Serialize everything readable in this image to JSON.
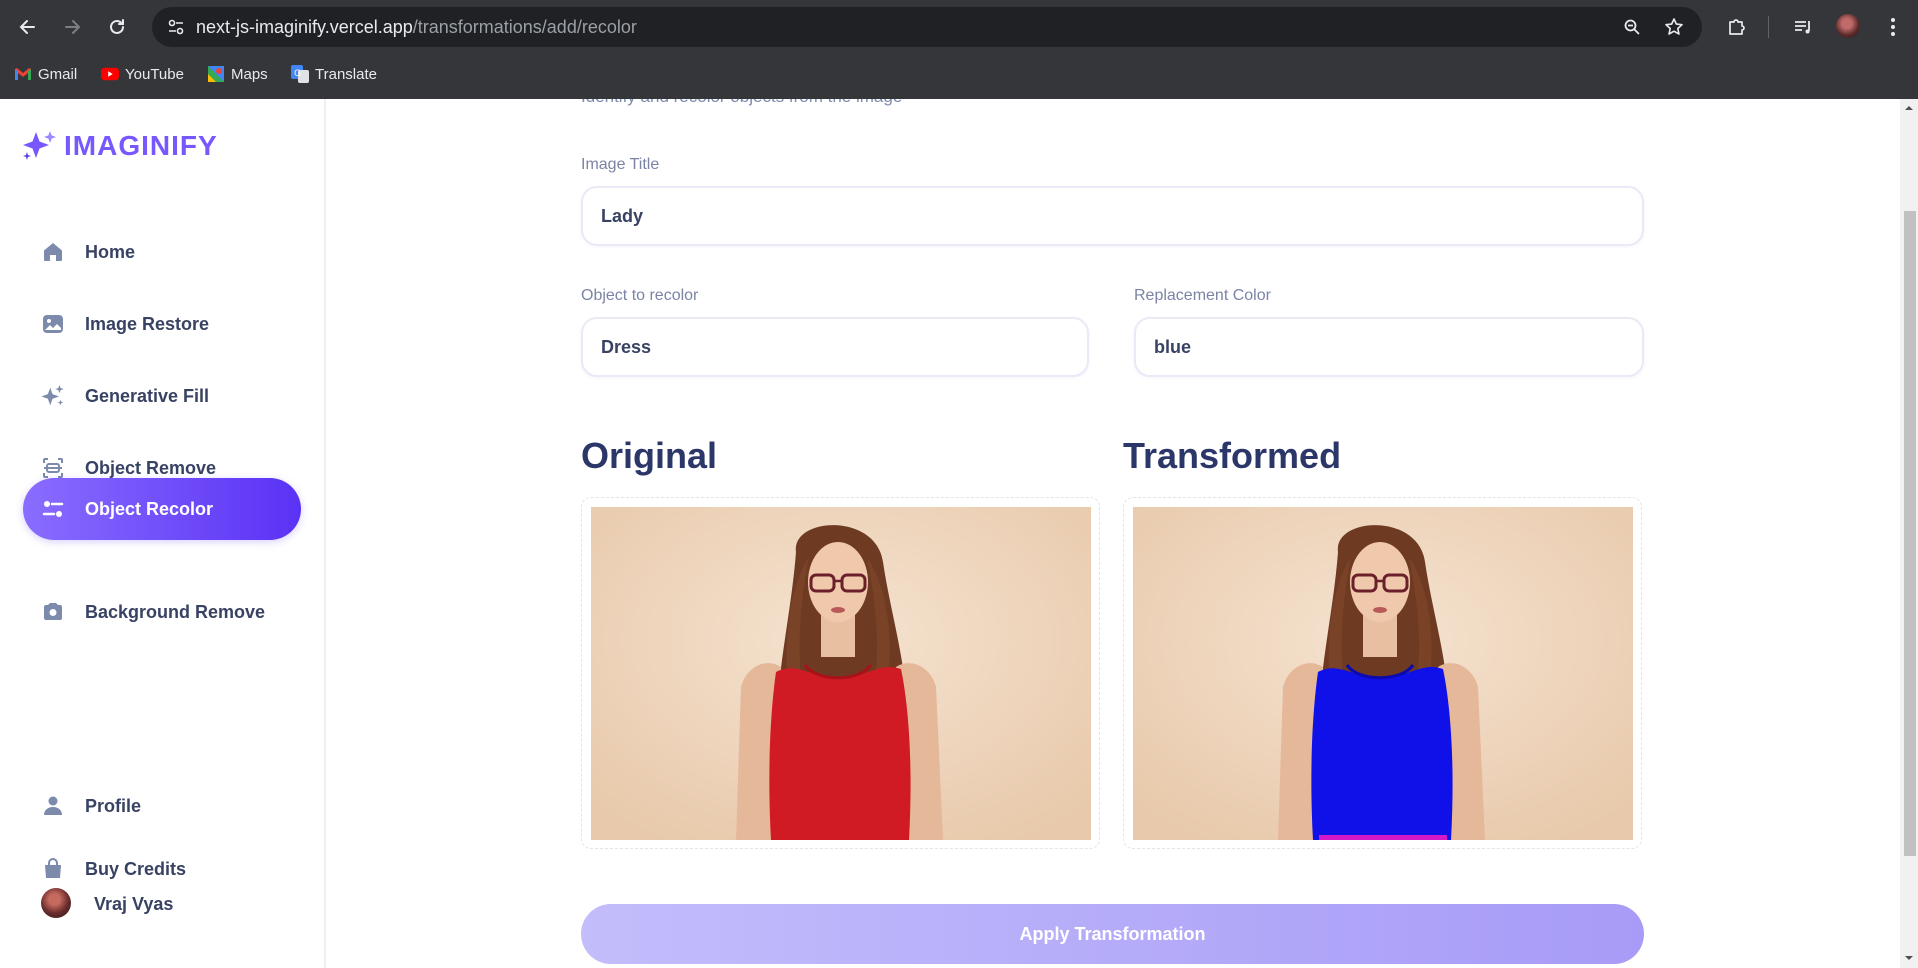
{
  "browser": {
    "url_host": "next-js-imaginify.vercel.app",
    "url_path": "/transformations/add/recolor",
    "bookmarks": [
      {
        "label": "Gmail",
        "icon": "gmail-icon"
      },
      {
        "label": "YouTube",
        "icon": "youtube-icon"
      },
      {
        "label": "Maps",
        "icon": "maps-icon"
      },
      {
        "label": "Translate",
        "icon": "translate-icon"
      }
    ]
  },
  "sidebar": {
    "logo_text": "IMAGINIFY",
    "items": [
      {
        "label": "Home",
        "icon": "home-icon",
        "active": false
      },
      {
        "label": "Image Restore",
        "icon": "image-icon",
        "active": false
      },
      {
        "label": "Generative Fill",
        "icon": "stars-icon",
        "active": false
      },
      {
        "label": "Object Remove",
        "icon": "scan-icon",
        "active": false
      },
      {
        "label": "Object Recolor",
        "icon": "filter-icon",
        "active": true
      },
      {
        "label": "Background Remove",
        "icon": "camera-icon",
        "active": false
      }
    ],
    "bottom_items": [
      {
        "label": "Profile",
        "icon": "profile-icon"
      },
      {
        "label": "Buy Credits",
        "icon": "bag-icon"
      }
    ],
    "user_name": "Vraj Vyas"
  },
  "main": {
    "subtitle": "Identify and recolor objects from the image",
    "image_title_label": "Image Title",
    "image_title_value": "Lady",
    "object_label": "Object to recolor",
    "object_value": "Dress",
    "color_label": "Replacement Color",
    "color_value": "blue",
    "original_heading": "Original",
    "transformed_heading": "Transformed",
    "apply_button": "Apply Transformation"
  },
  "colors": {
    "accent": "#6a4cf8",
    "original_dress": "#d01a24",
    "transformed_dress": "#1010e8"
  }
}
